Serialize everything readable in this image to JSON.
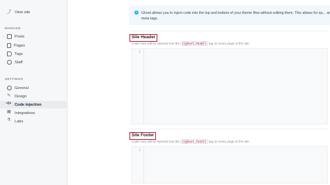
{
  "sidebar": {
    "view_site": "View site",
    "manage_label": "MANAGE",
    "manage_items": [
      {
        "label": "Posts",
        "icon": "posts-icon",
        "expandable": true
      },
      {
        "label": "Pages",
        "icon": "pages-icon"
      },
      {
        "label": "Tags",
        "icon": "tag-icon"
      },
      {
        "label": "Staff",
        "icon": "staff-icon"
      }
    ],
    "settings_label": "SETTINGS",
    "settings_items": [
      {
        "label": "General",
        "icon": "gear-icon"
      },
      {
        "label": "Design",
        "icon": "brush-icon"
      },
      {
        "label": "Code injection",
        "icon": "code-icon",
        "active": true
      },
      {
        "label": "Integrations",
        "icon": "integrations-icon"
      },
      {
        "label": "Labs",
        "icon": "flask-icon"
      }
    ]
  },
  "notice": {
    "icon": "info-icon",
    "text": "Ghost allows you to inject code into the top and bottom of your theme files without editing them. This allows for qu... and meta tags."
  },
  "header_section": {
    "title": "Site Header",
    "desc_before": "Code here will be injected into the",
    "code": "{{ghost_head}}",
    "desc_after": "tag on every page of the site",
    "line_number": "1"
  },
  "footer_section": {
    "title": "Site Footer",
    "desc_before": "Code here will be injected into the",
    "code": "{{ghost_foot}}",
    "desc_after": "tag on every page of the site",
    "line_number": "1"
  },
  "colors": {
    "highlight_border": "#c8102e",
    "info_accent": "#14b8ff",
    "sidebar_bg": "#f6f7f8",
    "active_item_bg": "#e9ecef"
  }
}
